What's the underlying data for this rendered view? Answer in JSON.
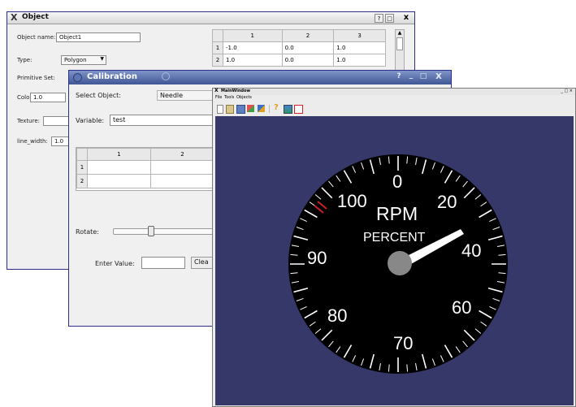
{
  "object_window": {
    "title": "Object",
    "title_buttons": [
      "?",
      "□",
      "x"
    ],
    "name_label": "Object name:",
    "name_value": "Object1",
    "type_label": "Type:",
    "type_value": "Polygon",
    "primitive_label": "Primitive Set:",
    "color_label": "Color:",
    "color_value": "1.0",
    "texture_label": "Texture:",
    "line_width_label": "line_width:",
    "line_width_value": "1.0",
    "table": {
      "columns": [
        "1",
        "2",
        "3"
      ],
      "rows": [
        {
          "header": "1",
          "cells": [
            "-1.0",
            "0.0",
            "1.0"
          ]
        },
        {
          "header": "2",
          "cells": [
            "1.0",
            "0.0",
            "1.0"
          ]
        }
      ]
    }
  },
  "calibration_window": {
    "title": "Calibration",
    "title_buttons": [
      "?",
      "_",
      "□",
      "X"
    ],
    "select_label": "Select Object:",
    "select_value": "Needle",
    "variable_label": "Variable:",
    "variable_value": "test",
    "table": {
      "columns": [
        "1",
        "2"
      ],
      "rows": [
        {
          "header": "1",
          "cells": [
            "",
            ""
          ]
        },
        {
          "header": "2",
          "cells": [
            "",
            ""
          ]
        }
      ]
    },
    "rotate_label": "Rotate:",
    "enter_value_label": "Enter Value:",
    "clear_button": "Clea"
  },
  "main_window": {
    "title": "MainWindow",
    "menu": [
      "File",
      "Tools",
      "Objects"
    ],
    "toolbar_icons": [
      "new-icon",
      "open-icon",
      "save-icon",
      "shapes-icon",
      "paint-icon",
      "help-icon",
      "picture-icon",
      "rectangle-icon"
    ],
    "gauge": {
      "unit_label": "RPM",
      "sub_label": "PERCENT",
      "scale_labels": [
        "100",
        "0",
        "20",
        "40",
        "60",
        "70",
        "80",
        "90"
      ],
      "needle_value": "40",
      "colors": {
        "background": "#353868",
        "dial": "#000000",
        "needle": "#ffffff",
        "hub": "#888888",
        "redline": "#cc2222"
      }
    }
  }
}
